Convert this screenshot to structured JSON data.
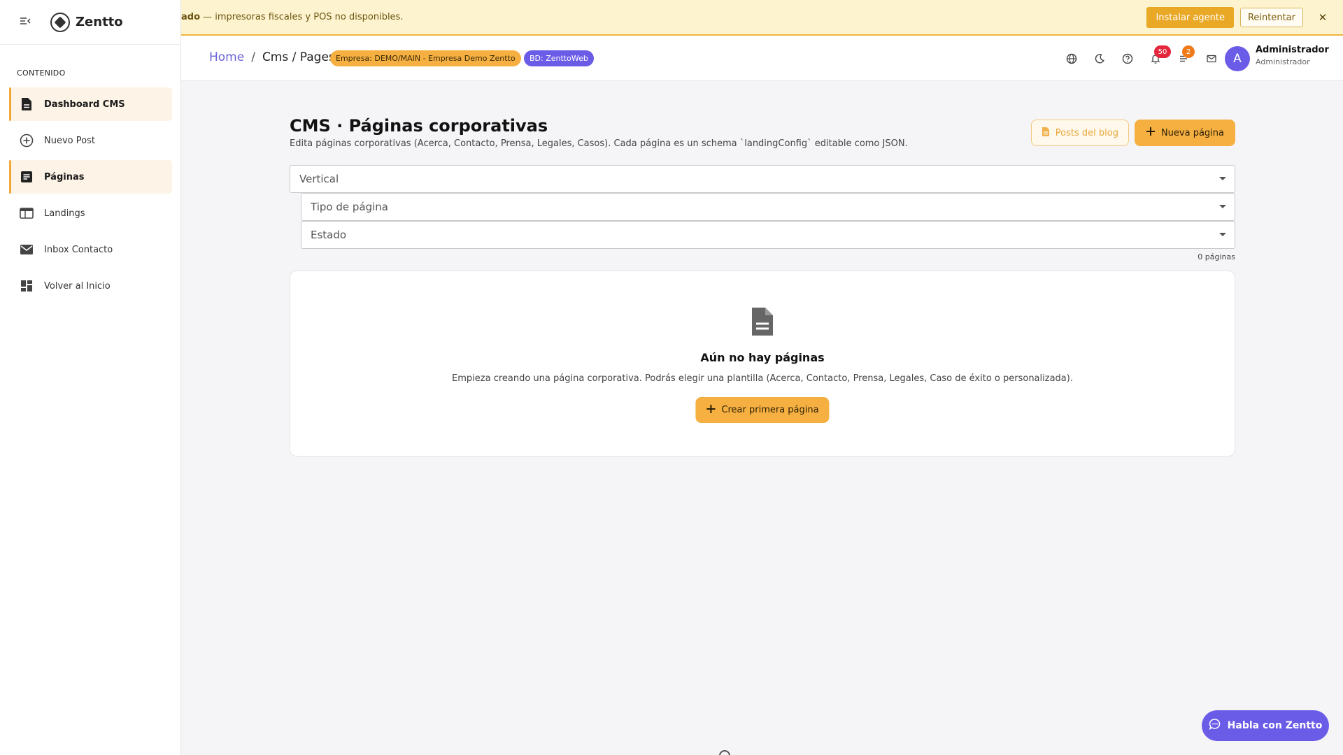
{
  "alert": {
    "bold_text": "ado",
    "text": " — impresoras fiscales y POS no disponibles.",
    "install_label": "Instalar agente",
    "retry_label": "Reintentar",
    "close_label": "✕"
  },
  "sidebar": {
    "brand": "Zentto",
    "section": "CONTENIDO",
    "items": [
      {
        "label": "Dashboard CMS",
        "icon": "document-icon"
      },
      {
        "label": "Nuevo Post",
        "icon": "plus-circle-icon"
      },
      {
        "label": "Páginas",
        "icon": "article-icon"
      },
      {
        "label": "Landings",
        "icon": "web-icon"
      },
      {
        "label": "Inbox Contacto",
        "icon": "mail-icon"
      },
      {
        "label": "Volver al Inicio",
        "icon": "dashboard-icon"
      }
    ]
  },
  "header": {
    "breadcrumb": {
      "home": "Home",
      "separator": "/",
      "current": "Cms / Pages"
    },
    "company_chip": "Empresa: DEMO/MAIN - Empresa Demo Zentto",
    "db_chip": "BD: ZenttoWeb",
    "notifications_count": "50",
    "tasks_count": "2",
    "avatar_initial": "A",
    "user_name": "Administrador",
    "user_role": "Administrador"
  },
  "main": {
    "title": "CMS · Páginas corporativas",
    "subtitle": "Edita páginas corporativas (Acerca, Contacto, Prensa, Legales, Casos). Cada página es un schema `landingConfig` editable como JSON.",
    "blog_button": "Posts del blog",
    "new_button": "Nueva página",
    "filters": {
      "vertical": "Vertical",
      "page_type": "Tipo de página",
      "status": "Estado"
    },
    "count_text": "0 páginas",
    "empty": {
      "title": "Aún no hay páginas",
      "subtitle": "Empieza creando una página corporativa. Podrás elegir una plantilla (Acerca, Contacto, Prensa, Legales, Caso de éxito o personalizada).",
      "button": "Crear primera página"
    }
  },
  "chat": {
    "label": "Habla con Zentto"
  },
  "colors": {
    "accent": "#f6b042",
    "brand": "#6b5ce7",
    "alert_bg": "#fdf4cf"
  }
}
